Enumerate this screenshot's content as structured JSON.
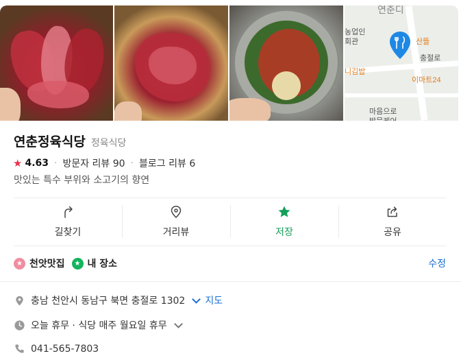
{
  "photos": {
    "items": [
      "meat-platter-photo",
      "marinated-meat-photo",
      "naengmyeon-bowl-photo"
    ],
    "map": {
      "labels": {
        "top": "연춘디",
        "bank": "농업인",
        "bank2": "회관",
        "restaurant_near": "산뜰",
        "road": "충절로",
        "kimbap": "니김밥",
        "mart": "이마트24",
        "care1": "마음으로",
        "care2": "방문케어"
      }
    }
  },
  "place": {
    "name": "연춘정육식당",
    "category": "정육식당",
    "rating": "4.63",
    "visitor_reviews": "방문자 리뷰 90",
    "blog_reviews": "블로그 리뷰 6",
    "description": "맛있는 특수 부위와 소고기의 향연"
  },
  "actions": [
    {
      "label": "길찾기",
      "icon": "directions-icon"
    },
    {
      "label": "거리뷰",
      "icon": "location-pin-icon"
    },
    {
      "label": "저장",
      "icon": "star-icon",
      "active": true
    },
    {
      "label": "공유",
      "icon": "share-icon"
    }
  ],
  "saved_lists": {
    "list1": "천앗맛집",
    "list2": "내 장소",
    "edit_label": "수정"
  },
  "info": {
    "address": "충남 천안시 동남구 북면 충절로 1302",
    "map_link": "지도",
    "hours": "오늘 휴무 · 식당 매주 월요일 휴무",
    "phone": "041-565-7803"
  },
  "colors": {
    "accent_green": "#14a05a",
    "rating_red": "#e7334a",
    "link_blue": "#1a6fd3",
    "pin_blue": "#1e88e5"
  }
}
